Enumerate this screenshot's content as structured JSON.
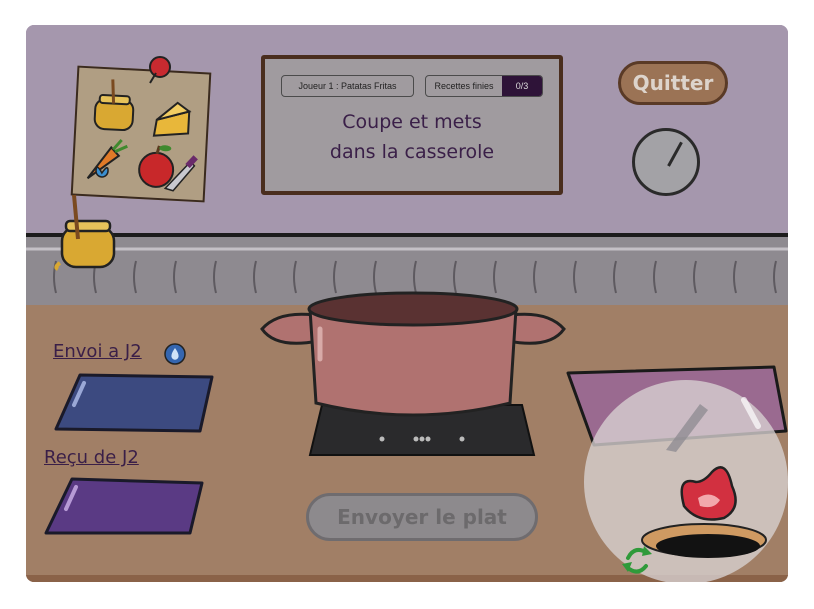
{
  "header": {
    "player_label": "Joueur 1 :  Patatas Fritas",
    "recipes_label": "Recettes finies",
    "recipes_count": "0/3"
  },
  "order": {
    "instruction_line1": "Coupe et mets",
    "instruction_line2": "dans la casserole"
  },
  "controls": {
    "quit_label": "Quitter",
    "serve_label": "Envoyer le plat",
    "serve_enabled": false
  },
  "exchange": {
    "send_label": "Envoi a J2",
    "receive_label": "Reçu de J2"
  },
  "timer": {
    "progress_fraction": 0.08
  },
  "recipe_card_icons": [
    "honey-jar-icon",
    "cheese-icon",
    "carrot-icon",
    "water-drop-icon",
    "apple-icon",
    "knife-icon"
  ],
  "colors": {
    "wall": "#a597ad",
    "floor": "#a17f66",
    "text_accent": "#3a1f48",
    "quit_button": "#9b7355",
    "send_tray": "#3c4a80",
    "receive_tray": "#5a3a84",
    "cutting_board": "#9a6a90",
    "drop_badge": "#3566b0"
  }
}
